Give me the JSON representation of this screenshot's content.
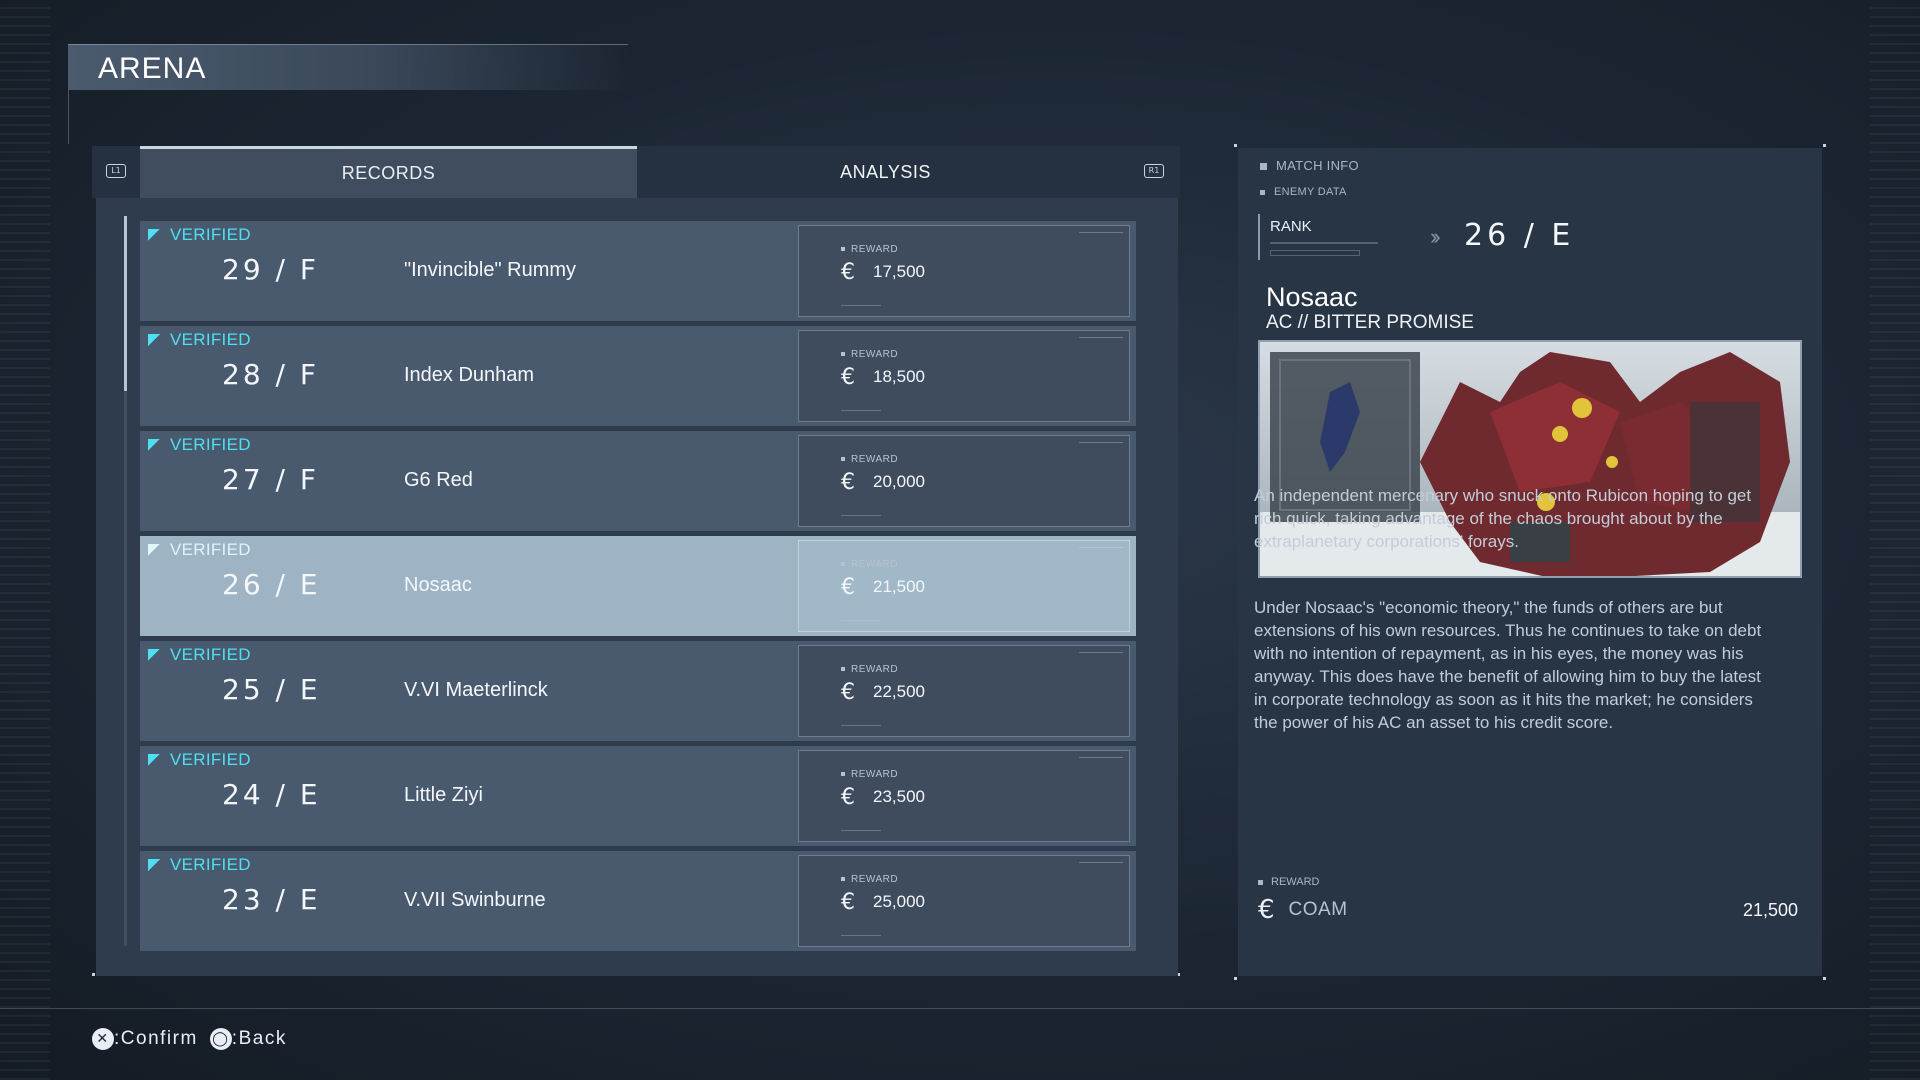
{
  "header": {
    "title": "ARENA"
  },
  "tabs": {
    "left_shoulder": "L1",
    "right_shoulder": "R1",
    "records": "RECORDS",
    "analysis": "ANALYSIS",
    "active": "RECORDS"
  },
  "records": [
    {
      "status": "VERIFIED",
      "rank": "29 / F",
      "pilot": "\"Invincible\" Rummy",
      "reward_label": "REWARD",
      "reward": "17,500",
      "selected": false
    },
    {
      "status": "VERIFIED",
      "rank": "28 / F",
      "pilot": "Index Dunham",
      "reward_label": "REWARD",
      "reward": "18,500",
      "selected": false
    },
    {
      "status": "VERIFIED",
      "rank": "27 / F",
      "pilot": "G6 Red",
      "reward_label": "REWARD",
      "reward": "20,000",
      "selected": false
    },
    {
      "status": "VERIFIED",
      "rank": "26 / E",
      "pilot": "Nosaac",
      "reward_label": "REWARD",
      "reward": "21,500",
      "selected": true
    },
    {
      "status": "VERIFIED",
      "rank": "25 / E",
      "pilot": "V.VI Maeterlinck",
      "reward_label": "REWARD",
      "reward": "22,500",
      "selected": false
    },
    {
      "status": "VERIFIED",
      "rank": "24 / E",
      "pilot": "Little Ziyi",
      "reward_label": "REWARD",
      "reward": "23,500",
      "selected": false
    },
    {
      "status": "VERIFIED",
      "rank": "23 / E",
      "pilot": "V.VII Swinburne",
      "reward_label": "REWARD",
      "reward": "25,000",
      "selected": false
    }
  ],
  "info": {
    "match_info_label": "MATCH INFO",
    "enemy_data_label": "ENEMY DATA",
    "rank_label": "RANK",
    "rank_value": "26 / E",
    "pilot_name": "Nosaac",
    "ac_name": "AC // BITTER PROMISE",
    "description_1": "An independent mercenary who snuck onto Rubicon hoping to get rich quick, taking advantage of the chaos brought about by the extraplanetary corporations' forays.",
    "description_2": "Under Nosaac's \"economic theory,\" the funds of others are but extensions of his own resources. Thus he continues to take on debt with no intention of repayment, as in his eyes, the money was his anyway. This does have the benefit of allowing him to buy the latest in corporate technology as soon as it hits the market; he considers the power of his AC an asset to his credit score.",
    "reward_label": "REWARD",
    "reward_currency": "COAM",
    "reward_amount": "21,500"
  },
  "footer": {
    "confirm_button": "✕",
    "confirm_label": ":Confirm",
    "back_button": "◯",
    "back_label": ":Back"
  },
  "colors": {
    "verified": "#4ee0f2",
    "row_bg": "#4a5a6e",
    "row_selected_bg": "#9eb4c4",
    "panel_bg": "#283545"
  },
  "icons": {
    "credit": "credit-icon",
    "verified": "flag-icon",
    "rank_arrows": "double-chevron-icon"
  }
}
